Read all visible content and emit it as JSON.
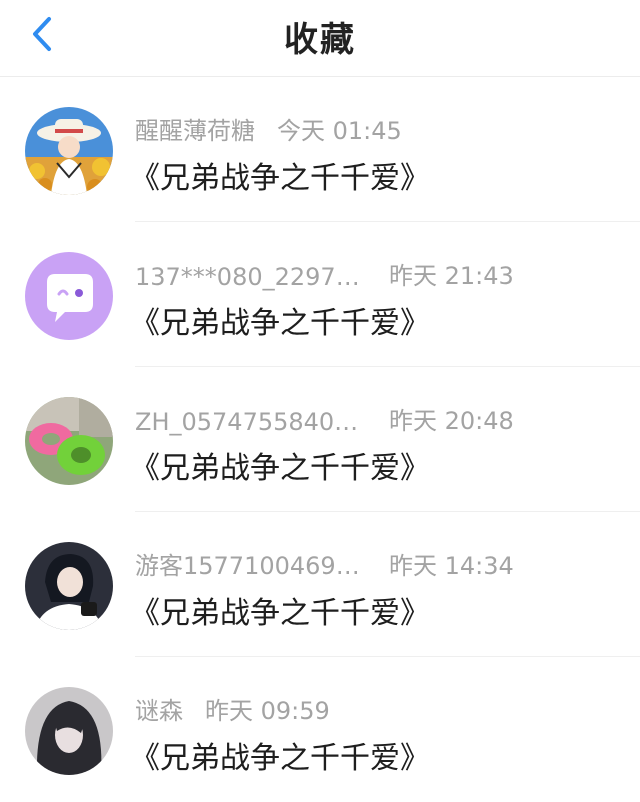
{
  "header": {
    "title": "收藏"
  },
  "items": [
    {
      "name": "醒醒薄荷糖",
      "time": "今天 01:45",
      "book": "《兄弟战争之千千爱》"
    },
    {
      "name": "137***080_2297…",
      "time": "昨天 21:43",
      "book": "《兄弟战争之千千爱》"
    },
    {
      "name": "ZH_0574755840…",
      "time": "昨天 20:48",
      "book": "《兄弟战争之千千爱》"
    },
    {
      "name": "游客1577100469…",
      "time": "昨天 14:34",
      "book": "《兄弟战争之千千爱》"
    },
    {
      "name": "谜森",
      "time": "昨天 09:59",
      "book": "《兄弟战争之千千爱》"
    }
  ],
  "colors": {
    "accent": "#2f8cf0",
    "meta": "#a3a3a3",
    "avatar_purple": "#c9a2f5"
  },
  "icons": {
    "back": "chevron-left-icon"
  }
}
